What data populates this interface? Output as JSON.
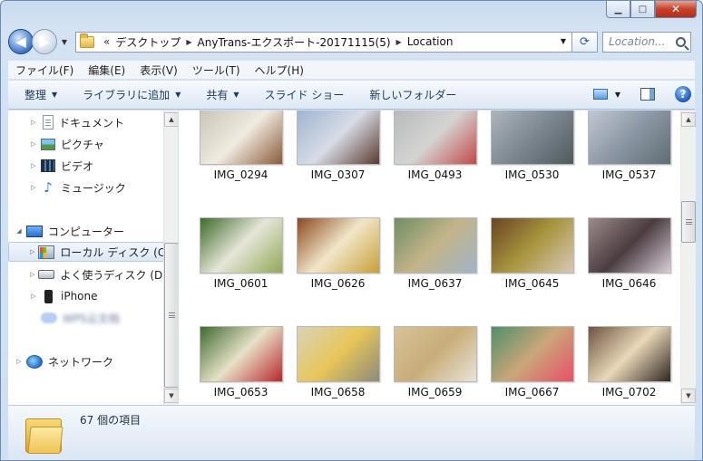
{
  "window": {
    "minimize_glyph": "▁",
    "maximize_glyph": "□",
    "close_glyph": "✕"
  },
  "address": {
    "overflow": "«",
    "crumbs": [
      "デスクトップ",
      "AnyTrans-エクスポート-20171115(5)",
      "Location"
    ],
    "search_placeholder": "Location..."
  },
  "menu": [
    "ファイル(F)",
    "編集(E)",
    "表示(V)",
    "ツール(T)",
    "ヘルプ(H)"
  ],
  "commands": [
    {
      "label": "整理",
      "dropdown": true
    },
    {
      "label": "ライブラリに追加",
      "dropdown": true
    },
    {
      "label": "共有",
      "dropdown": true
    },
    {
      "label": "スライド ショー",
      "dropdown": false
    },
    {
      "label": "新しいフォルダー",
      "dropdown": false
    }
  ],
  "help_label": "?",
  "nav": {
    "items": [
      {
        "name": "nav-documents",
        "icon": "document-icon",
        "label": "ドキュメント",
        "expander": "▷",
        "indent": 1
      },
      {
        "name": "nav-pictures",
        "icon": "pictures-icon",
        "label": "ピクチャ",
        "expander": "▷",
        "indent": 1
      },
      {
        "name": "nav-videos",
        "icon": "video-icon",
        "label": "ビデオ",
        "expander": "▷",
        "indent": 1
      },
      {
        "name": "nav-music",
        "icon": "music-icon",
        "label": "ミュージック",
        "expander": "▷",
        "indent": 1
      },
      {
        "name": "nav-computer",
        "icon": "computer-icon",
        "label": "コンピューター",
        "expander": "◢",
        "indent": 0
      },
      {
        "name": "nav-local-disk",
        "icon": "local-disk-icon",
        "label": "ローカル ディスク (C:",
        "expander": "▷",
        "indent": 1,
        "selected": true
      },
      {
        "name": "nav-frequent-disk",
        "icon": "drive-icon",
        "label": "よく使うディスク (D:",
        "expander": "▷",
        "indent": 1
      },
      {
        "name": "nav-iphone",
        "icon": "iphone-icon",
        "label": "iPhone",
        "expander": "▷",
        "indent": 1
      },
      {
        "name": "nav-wps-cloud",
        "icon": "cloud-icon",
        "label": "WPS云文档",
        "expander": "",
        "indent": 1,
        "blurred": true
      },
      {
        "name": "nav-network",
        "icon": "network-icon",
        "label": "ネットワーク",
        "expander": "▷",
        "indent": 0
      }
    ]
  },
  "files": [
    {
      "label": "IMG_0294",
      "colors": [
        "#c9c4b8",
        "#f0ebe0",
        "#8b5a3a"
      ]
    },
    {
      "label": "IMG_0307",
      "colors": [
        "#9fb3cf",
        "#d7dce6",
        "#5b3a2e"
      ]
    },
    {
      "label": "IMG_0493",
      "colors": [
        "#b7b9bb",
        "#d4d4d2",
        "#c24a4a"
      ]
    },
    {
      "label": "IMG_0530",
      "colors": [
        "#aeb6bd",
        "#7d8790",
        "#4f5a5c"
      ]
    },
    {
      "label": "IMG_0537",
      "colors": [
        "#c1c9d3",
        "#8c96a4",
        "#5e6d73"
      ]
    },
    {
      "label": "IMG_0601",
      "colors": [
        "#3d6b2a",
        "#e6e6d8",
        "#8fa856"
      ]
    },
    {
      "label": "IMG_0626",
      "colors": [
        "#8a4a20",
        "#f2e6c9",
        "#c89f37"
      ]
    },
    {
      "label": "IMG_0637",
      "colors": [
        "#6f8e63",
        "#c4b48a",
        "#9fb4c4"
      ]
    },
    {
      "label": "IMG_0645",
      "colors": [
        "#6b4422",
        "#a8963f",
        "#d8c8b8"
      ]
    },
    {
      "label": "IMG_0646",
      "colors": [
        "#9e8b8b",
        "#4a3c40",
        "#d8cfd8"
      ]
    },
    {
      "label": "IMG_0653",
      "colors": [
        "#3e6b2f",
        "#e6e1c8",
        "#b7282c"
      ]
    },
    {
      "label": "IMG_0658",
      "colors": [
        "#d9d2b9",
        "#e8c65a",
        "#8c8a78"
      ]
    },
    {
      "label": "IMG_0659",
      "colors": [
        "#d6c39a",
        "#c8ad78",
        "#e9e4d8"
      ]
    },
    {
      "label": "IMG_0667",
      "colors": [
        "#4f8f69",
        "#c9a77a",
        "#e84f6a"
      ]
    },
    {
      "label": "IMG_0702",
      "colors": [
        "#6e5440",
        "#e9d8b8",
        "#2e2620"
      ]
    }
  ],
  "status": {
    "count_text": "67 個の項目"
  }
}
